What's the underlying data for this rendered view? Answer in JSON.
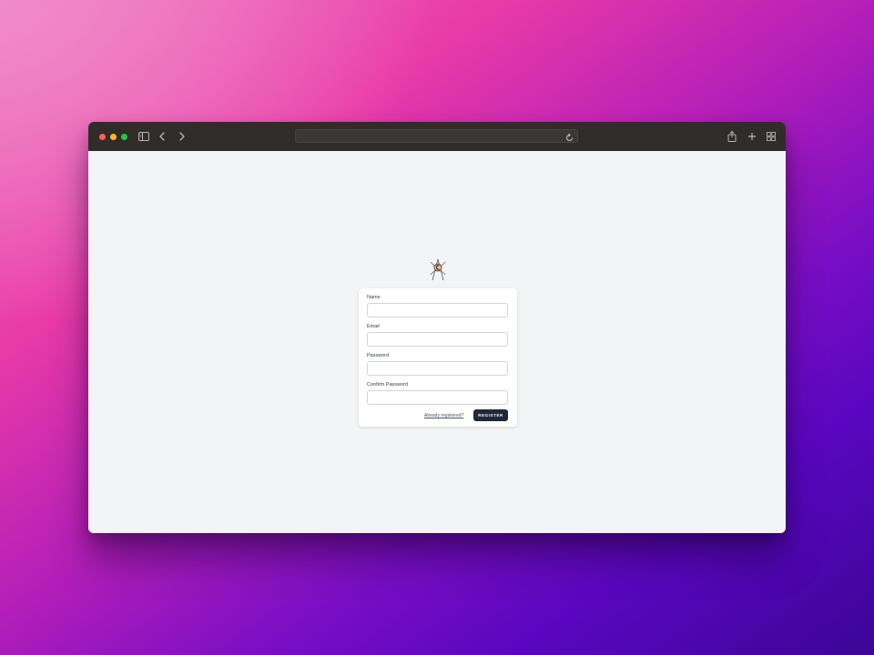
{
  "browser": {
    "address_value": "",
    "icons": {
      "sidebar": "sidebar-icon",
      "back": "chevron-left-icon",
      "forward": "chevron-right-icon",
      "reload": "reload-icon",
      "share": "share-icon",
      "new_tab": "plus-icon",
      "tab_overview": "grid-icon"
    },
    "traffic_light_colors": [
      "#fe5f57",
      "#febc2e",
      "#28c840"
    ]
  },
  "page": {
    "logo_icon": "app-logo-icon",
    "background_color": "#f3f4f6"
  },
  "form": {
    "fields": [
      {
        "label": "Name",
        "value": ""
      },
      {
        "label": "Email",
        "value": ""
      },
      {
        "label": "Password",
        "value": ""
      },
      {
        "label": "Confirm Password",
        "value": ""
      }
    ],
    "login_link": "Already registered?",
    "submit_label": "Register",
    "submit_color": "#1f2937"
  }
}
